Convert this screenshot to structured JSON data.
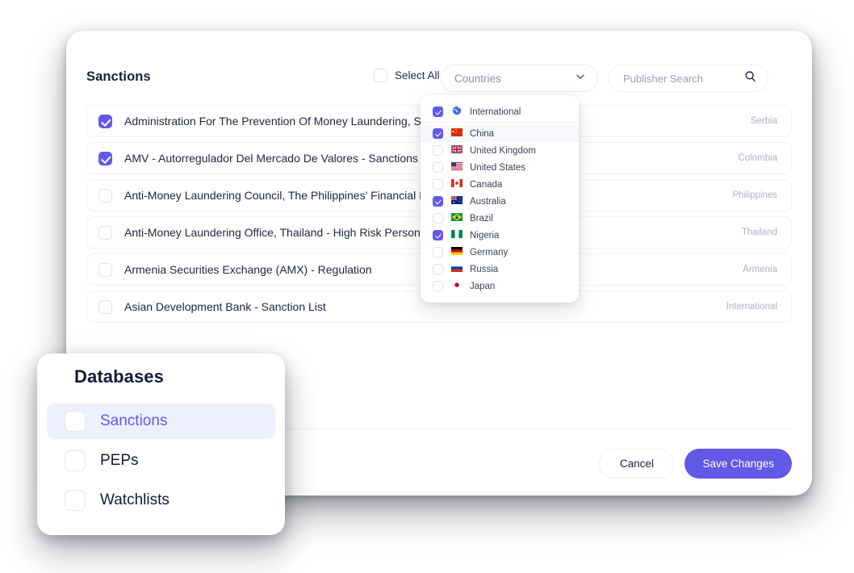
{
  "panel": {
    "title": "Sanctions",
    "select_all_label": "Select All",
    "select_all_checked": false
  },
  "countries_select": {
    "value": "Countries",
    "chevron_icon": "chevron-down-icon",
    "open": true
  },
  "publisher_search": {
    "placeholder": "Publisher Search",
    "value": "",
    "search_icon": "search-icon"
  },
  "publishers": [
    {
      "label": "Administration For The Prevention Of Money Laundering, Serbia",
      "country": "Serbia",
      "checked": true
    },
    {
      "label": "AMV - Autorregulador Del Mercado De Valores - Sanctions",
      "country": "Colombia",
      "checked": true
    },
    {
      "label": "Anti-Money Laundering Council, The Philippines' Financial Intelligence Unit",
      "country": "Philippines",
      "checked": false
    },
    {
      "label": "Anti-Money Laundering Office, Thailand - High Risk Persons List",
      "country": "Thailand",
      "checked": false
    },
    {
      "label": "Armenia Securities Exchange (AMX) - Regulation",
      "country": "Armenia",
      "checked": false
    },
    {
      "label": "Asian Development Bank - Sanction List",
      "country": "International",
      "checked": false
    }
  ],
  "countries_dropdown": [
    {
      "label": "International",
      "flag": "globe-icon",
      "checked": true,
      "highlighted": false,
      "separator": true
    },
    {
      "label": "China",
      "flag": "flag-china",
      "checked": true,
      "highlighted": true,
      "separator": false
    },
    {
      "label": "United Kingdom",
      "flag": "flag-united-kingdom",
      "checked": false,
      "highlighted": false,
      "separator": false
    },
    {
      "label": "United States",
      "flag": "flag-united-states",
      "checked": false,
      "highlighted": false,
      "separator": false
    },
    {
      "label": "Canada",
      "flag": "flag-canada",
      "checked": false,
      "highlighted": false,
      "separator": false
    },
    {
      "label": "Australia",
      "flag": "flag-australia",
      "checked": true,
      "highlighted": false,
      "separator": false
    },
    {
      "label": "Brazil",
      "flag": "flag-brazil",
      "checked": false,
      "highlighted": false,
      "separator": false
    },
    {
      "label": "Nigeria",
      "flag": "flag-nigeria",
      "checked": true,
      "highlighted": false,
      "separator": false
    },
    {
      "label": "Germany",
      "flag": "flag-germany",
      "checked": false,
      "highlighted": false,
      "separator": false
    },
    {
      "label": "Russia",
      "flag": "flag-russia",
      "checked": false,
      "highlighted": false,
      "separator": false
    },
    {
      "label": "Japan",
      "flag": "flag-japan",
      "checked": false,
      "highlighted": false,
      "separator": false
    }
  ],
  "footer": {
    "cancel_label": "Cancel",
    "save_label": "Save Changes"
  },
  "databases": {
    "title": "Databases",
    "items": [
      {
        "label": "Sanctions",
        "checked": false,
        "active": true
      },
      {
        "label": "PEPs",
        "checked": false,
        "active": false
      },
      {
        "label": "Watchlists",
        "checked": false,
        "active": false
      }
    ]
  },
  "colors": {
    "accent": "#6259e8",
    "accent_soft": "#eef0fd",
    "title": "#141c33",
    "muted": "#adb2c4",
    "border": "#f0f1f6"
  }
}
